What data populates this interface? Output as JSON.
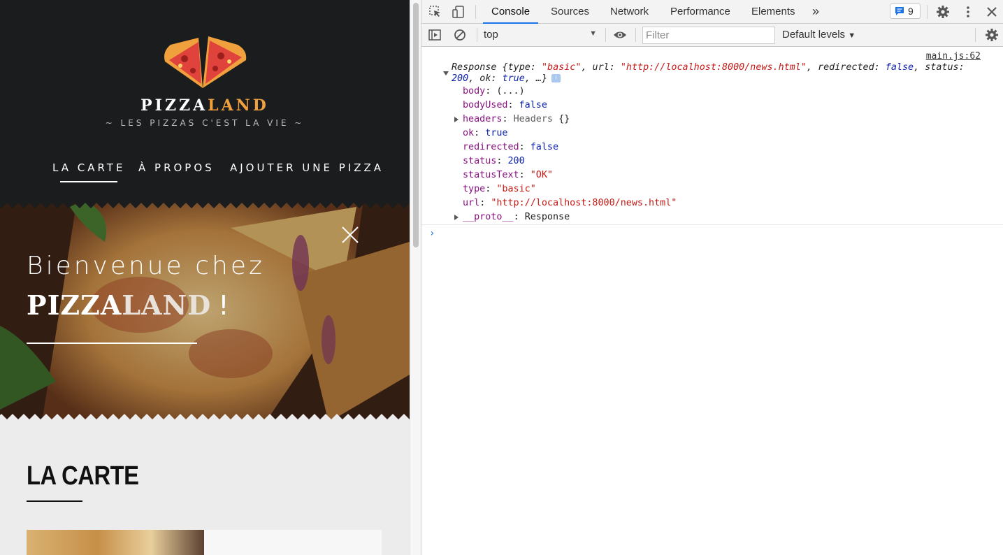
{
  "site": {
    "brand_a": "PIZZA",
    "brand_b": "LAND",
    "tagline": "~ LES PIZZAS C'EST LA VIE ~",
    "nav": [
      {
        "label": "LA CARTE",
        "active": true
      },
      {
        "label": "À PROPOS",
        "active": false
      },
      {
        "label": "AJOUTER UNE PIZZA",
        "active": false
      }
    ],
    "hero": {
      "welcome": "Bienvenue chez",
      "brand_a": "PIZZA",
      "brand_b": "LAND",
      "excl": "!"
    },
    "menu_title": "LA CARTE",
    "colors": {
      "accent": "#f0a03c",
      "header_bg": "#1b1c1d"
    }
  },
  "devtools": {
    "tabs": [
      "Console",
      "Sources",
      "Network",
      "Performance",
      "Elements"
    ],
    "active_tab": "Console",
    "more_tabs": "»",
    "issues_count": "9",
    "context": "top",
    "filter_placeholder": "Filter",
    "levels": "Default levels",
    "source_link": "main.js:62",
    "summary": {
      "label": "Response",
      "line1_rest": " {type: \"basic\", url: \"http://localhost:8000/news.html\", redirected: false, status:",
      "line2": "200, ok: true, …}"
    },
    "props": [
      {
        "key": "body",
        "sep": ": ",
        "value": "(...)",
        "kind": "plain",
        "expandable": false
      },
      {
        "key": "bodyUsed",
        "sep": ": ",
        "value": "false",
        "kind": "bool",
        "expandable": false
      },
      {
        "key": "headers",
        "sep": ": ",
        "value": "Headers {}",
        "kind": "obj",
        "expandable": true
      },
      {
        "key": "ok",
        "sep": ": ",
        "value": "true",
        "kind": "bool",
        "expandable": false
      },
      {
        "key": "redirected",
        "sep": ": ",
        "value": "false",
        "kind": "bool",
        "expandable": false
      },
      {
        "key": "status",
        "sep": ": ",
        "value": "200",
        "kind": "bool",
        "expandable": false
      },
      {
        "key": "statusText",
        "sep": ": ",
        "value": "\"OK\"",
        "kind": "str",
        "expandable": false
      },
      {
        "key": "type",
        "sep": ": ",
        "value": "\"basic\"",
        "kind": "str",
        "expandable": false
      },
      {
        "key": "url",
        "sep": ": ",
        "value": "\"http://localhost:8000/news.html\"",
        "kind": "str",
        "expandable": false
      },
      {
        "key": "__proto__",
        "sep": ": ",
        "value": "Response",
        "kind": "plain",
        "expandable": true
      }
    ],
    "prompt": "›"
  }
}
